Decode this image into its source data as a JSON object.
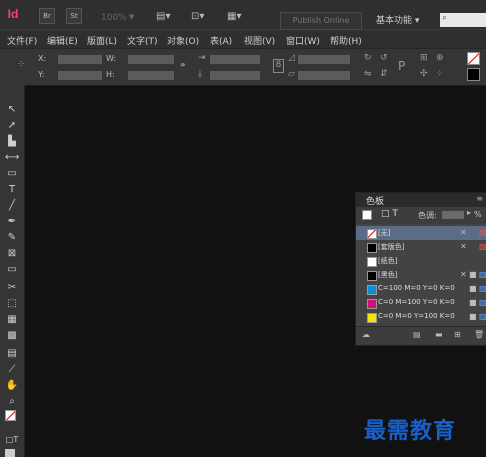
{
  "app": {
    "logo": "Id"
  },
  "title_bar": {
    "btn_br": "Br",
    "btn_st": "St",
    "zoom": "100%",
    "zoom_caret": "▼",
    "publish": "Publish Online",
    "workspace": "基本功能 ▾",
    "search_icon": "search-icon"
  },
  "menu": {
    "items": [
      "文件(F)",
      "编辑(E)",
      "版面(L)",
      "文字(T)",
      "对象(O)",
      "表(A)",
      "视图(V)",
      "窗口(W)",
      "帮助(H)"
    ]
  },
  "control": {
    "x": "X:",
    "y": "Y:",
    "w": "W:",
    "h": "H:"
  },
  "swatches_panel": {
    "title": "色板",
    "tint_label": "色调:",
    "tint_unit": "%",
    "swatches": [
      {
        "name": "[无]",
        "color": "none",
        "selected": true
      },
      {
        "name": "[套版色]",
        "color": "#000000"
      },
      {
        "name": "[纸色]",
        "color": "#ffffff"
      },
      {
        "name": "[黑色]",
        "color": "#000000"
      },
      {
        "name": "C=100 M=0 Y=0 K=0",
        "color": "#0a8fd6"
      },
      {
        "name": "C=0 M=100 Y=0 K=0",
        "color": "#d0117a"
      },
      {
        "name": "C=0 M=0 Y=100 K=0",
        "color": "#f2e500"
      }
    ]
  },
  "watermark": "最需教育"
}
